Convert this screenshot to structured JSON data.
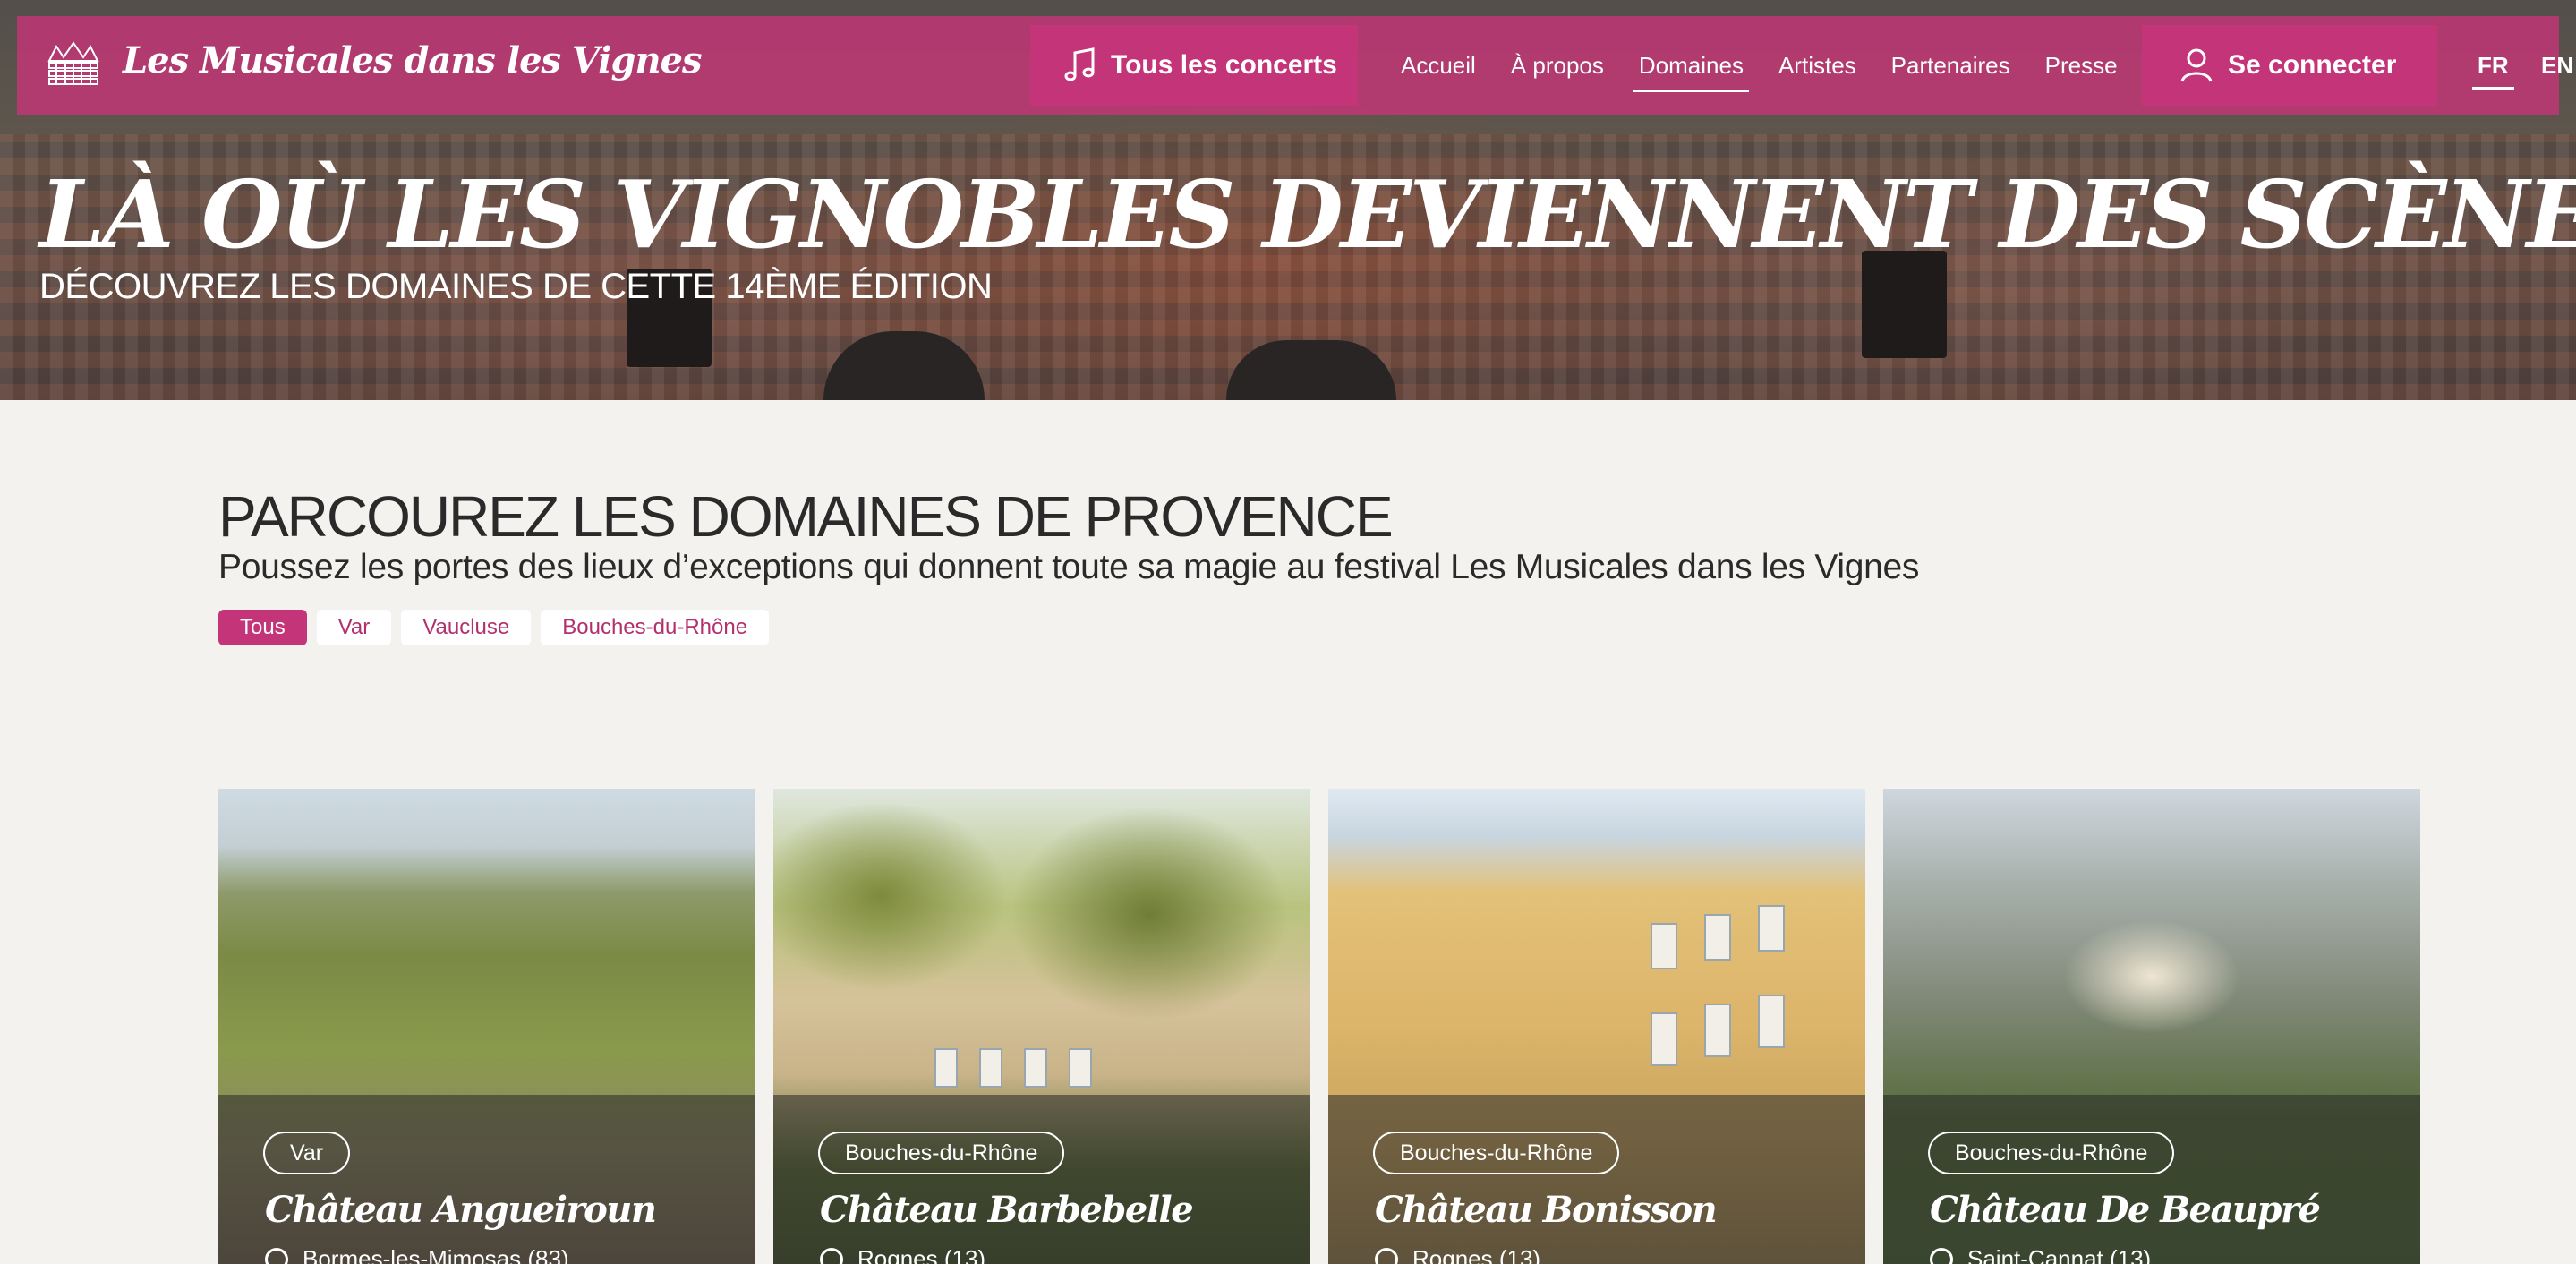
{
  "header": {
    "brand": "Les Musicales dans les Vignes",
    "concerts_button": "Tous les concerts",
    "nav": [
      "Accueil",
      "À propos",
      "Domaines",
      "Artistes",
      "Partenaires",
      "Presse"
    ],
    "active_nav": "Domaines",
    "login_button": "Se connecter",
    "languages": [
      "FR",
      "EN"
    ],
    "active_language": "FR"
  },
  "hero": {
    "title": "LÀ OÙ LES VIGNOBLES DEVIENNENT DES SCÈNES",
    "subtitle": "DÉCOUVREZ LES DOMAINES DE CETTE 14ÈME ÉDITION"
  },
  "section": {
    "title": "PARCOUREZ LES DOMAINES DE PROVENCE",
    "subtitle": "Poussez les portes des lieux d’exceptions qui donnent toute sa magie au festival Les Musicales dans les Vignes",
    "filters": [
      "Tous",
      "Var",
      "Vaucluse",
      "Bouches-du-Rhône"
    ],
    "active_filter": "Tous"
  },
  "domains": [
    {
      "region": "Var",
      "name": "Château Angueiroun",
      "location": "Bormes-les-Mimosas (83)"
    },
    {
      "region": "Bouches-du-Rhône",
      "name": "Château Barbebelle",
      "location": "Rognes (13)"
    },
    {
      "region": "Bouches-du-Rhône",
      "name": "Château Bonisson",
      "location": "Rognes (13)"
    },
    {
      "region": "Bouches-du-Rhône",
      "name": "Château De Beaupré",
      "location": "Saint-Cannat (13)"
    }
  ],
  "colors": {
    "accent": "#c43478",
    "background": "#f4f2ee",
    "text": "#2a2a2a"
  },
  "icons": [
    "crown-logo-icon",
    "music-note-icon",
    "user-icon",
    "location-pin-icon"
  ]
}
